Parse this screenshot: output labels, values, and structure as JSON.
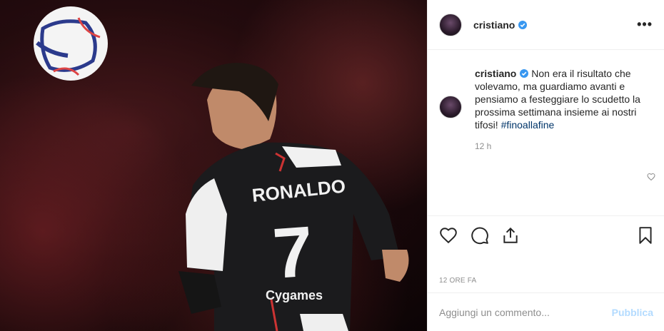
{
  "post": {
    "username": "cristiano",
    "caption_user": "cristiano",
    "caption_text": "Non era il risultato che volevamo, ma guardiamo avanti e pensiamo a festeggiare lo scudetto la prossima settimana insieme ai nostri tifosi!",
    "hashtag": "#finoallafine",
    "caption_time": "12 h",
    "post_date": "12 ORE FA",
    "jersey_name": "RONALDO",
    "jersey_number": "7",
    "sponsor": "Cygames"
  },
  "comment_box": {
    "placeholder": "Aggiungi un commento...",
    "publish_label": "Pubblica"
  },
  "colors": {
    "verified": "#3897f0",
    "hashtag": "#003569",
    "publish_disabled": "#b3dbff"
  },
  "icons": [
    "verified-badge-icon",
    "more-options-icon",
    "heart-icon",
    "comment-icon",
    "share-icon",
    "bookmark-icon",
    "small-heart-icon"
  ]
}
